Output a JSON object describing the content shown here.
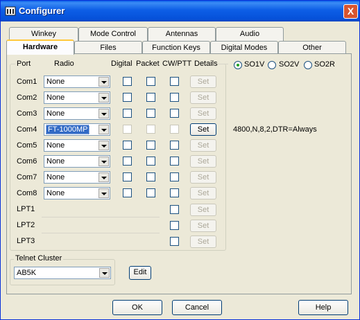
{
  "window": {
    "title": "Configurer",
    "close_glyph": "X"
  },
  "tabs_row1": [
    "Winkey",
    "Mode Control",
    "Antennas",
    "Audio"
  ],
  "tabs_row2": [
    "Hardware",
    "Files",
    "Function Keys",
    "Digital Modes",
    "Other"
  ],
  "headers": {
    "port": "Port",
    "radio": "Radio",
    "digital": "Digital",
    "packet": "Packet",
    "cwptt": "CW/PTT",
    "details": "Details"
  },
  "so_options": [
    "SO1V",
    "SO2V",
    "SO2R"
  ],
  "so_selected": "SO1V",
  "com_ports": [
    {
      "port": "Com1",
      "radio": "None",
      "set": "Set",
      "enabled": false,
      "info": ""
    },
    {
      "port": "Com2",
      "radio": "None",
      "set": "Set",
      "enabled": false,
      "info": ""
    },
    {
      "port": "Com3",
      "radio": "None",
      "set": "Set",
      "enabled": false,
      "info": ""
    },
    {
      "port": "Com4",
      "radio": "FT-1000MP",
      "set": "Set",
      "enabled": true,
      "info": "4800,N,8,2,DTR=Always"
    },
    {
      "port": "Com5",
      "radio": "None",
      "set": "Set",
      "enabled": false,
      "info": ""
    },
    {
      "port": "Com6",
      "radio": "None",
      "set": "Set",
      "enabled": false,
      "info": ""
    },
    {
      "port": "Com7",
      "radio": "None",
      "set": "Set",
      "enabled": false,
      "info": ""
    },
    {
      "port": "Com8",
      "radio": "None",
      "set": "Set",
      "enabled": false,
      "info": ""
    }
  ],
  "lpt_ports": [
    {
      "port": "LPT1",
      "set": "Set"
    },
    {
      "port": "LPT2",
      "set": "Set"
    },
    {
      "port": "LPT3",
      "set": "Set"
    }
  ],
  "telnet": {
    "label": "Telnet Cluster",
    "value": "AB5K",
    "edit": "Edit"
  },
  "buttons": {
    "ok": "OK",
    "cancel": "Cancel",
    "help": "Help"
  },
  "colors": {
    "titlebar": "#0a5fe8",
    "face": "#ece9d8",
    "selection": "#316ac5",
    "close": "#d8552f"
  }
}
